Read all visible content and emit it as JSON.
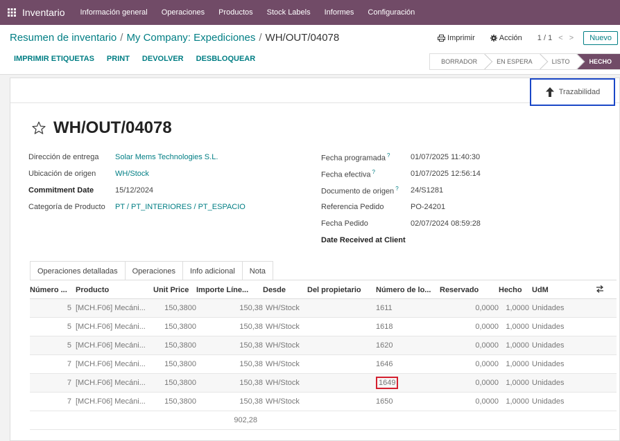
{
  "nav": {
    "brand": "Inventario",
    "menu": [
      "Información general",
      "Operaciones",
      "Productos",
      "Stock Labels",
      "Informes",
      "Configuración"
    ]
  },
  "breadcrumb": {
    "items": [
      "Resumen de inventario",
      "My Company: Expediciones"
    ],
    "current": "WH/OUT/04078"
  },
  "actions": {
    "print": "Imprimir",
    "action": "Acción",
    "pager": "1 / 1",
    "new": "Nuevo"
  },
  "toolbar": [
    "IMPRIMIR ETIQUETAS",
    "PRINT",
    "DEVOLVER",
    "DESBLOQUEAR"
  ],
  "status": {
    "steps": [
      "BORRADOR",
      "EN ESPERA",
      "LISTO",
      "HECHO"
    ],
    "active_index": 3
  },
  "trace_button": "Trazabilidad",
  "record": {
    "name": "WH/OUT/04078",
    "left_fields": [
      {
        "label": "Dirección de entrega",
        "value": "Solar Mems Technologies S.L."
      },
      {
        "label": "Ubicación de origen",
        "value": "WH/Stock"
      },
      {
        "label": "Commitment Date",
        "value": "15/12/2024"
      },
      {
        "label": "Categoría de Producto",
        "value": "PT / PT_INTERIORES / PT_ESPACIO"
      }
    ],
    "right_fields": [
      {
        "label": "Fecha programada",
        "value": "01/07/2025 11:40:30"
      },
      {
        "label": "Fecha efectiva",
        "value": "01/07/2025 12:56:14"
      },
      {
        "label": "Documento de origen",
        "value": "24/S1281"
      },
      {
        "label": "Referencia Pedido",
        "value": "PO-24201"
      },
      {
        "label": "Fecha Pedido",
        "value": "02/07/2024 08:59:28"
      },
      {
        "label": "Date Received at Client",
        "value": ""
      }
    ]
  },
  "tabs": [
    "Operaciones detalladas",
    "Operaciones",
    "Info adicional",
    "Nota"
  ],
  "table": {
    "headers": [
      "Número ...",
      "Producto",
      "Unit Price",
      "Importe Líne...",
      "Desde",
      "Del propietario",
      "Número de lo...",
      "Reservado",
      "Hecho",
      "UdM"
    ],
    "rows": [
      [
        "5",
        "[MCH.F06] Mecáni...",
        "150,3800",
        "150,38",
        "WH/Stock",
        "",
        "1611",
        "0,0000",
        "1,0000",
        "Unidades"
      ],
      [
        "5",
        "[MCH.F06] Mecáni...",
        "150,3800",
        "150,38",
        "WH/Stock",
        "",
        "1618",
        "0,0000",
        "1,0000",
        "Unidades"
      ],
      [
        "5",
        "[MCH.F06] Mecáni...",
        "150,3800",
        "150,38",
        "WH/Stock",
        "",
        "1620",
        "0,0000",
        "1,0000",
        "Unidades"
      ],
      [
        "7",
        "[MCH.F06] Mecáni...",
        "150,3800",
        "150,38",
        "WH/Stock",
        "",
        "1646",
        "0,0000",
        "1,0000",
        "Unidades"
      ],
      [
        "7",
        "[MCH.F06] Mecáni...",
        "150,3800",
        "150,38",
        "WH/Stock",
        "",
        "1649",
        "0,0000",
        "1,0000",
        "Unidades"
      ],
      [
        "7",
        "[MCH.F06] Mecáni...",
        "150,3800",
        "150,38",
        "WH/Stock",
        "",
        "1650",
        "0,0000",
        "1,0000",
        "Unidades"
      ]
    ],
    "highlighted_row": 4,
    "total": "902,28"
  },
  "colors": {
    "brand": "#714b67",
    "link": "#017e84",
    "highlight_box": "#1a47c7",
    "highlight_cell": "#d4202f"
  }
}
